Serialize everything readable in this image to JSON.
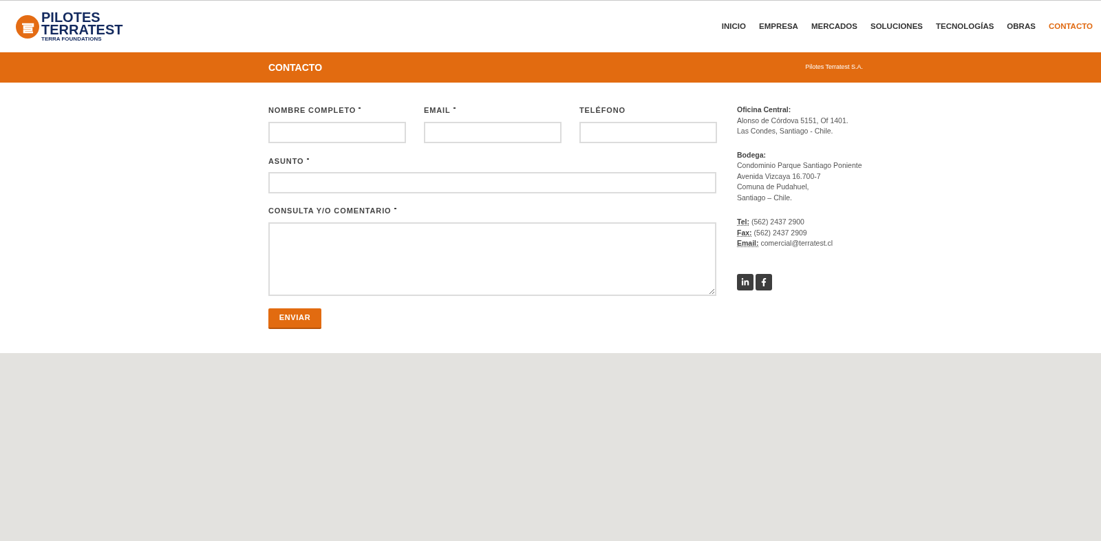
{
  "logo": {
    "line_1": "PILOTES",
    "line_2": "TERRATEST",
    "tagline": "TERRA FOUNDATIONS"
  },
  "nav": [
    {
      "label": "INICIO",
      "selected": false
    },
    {
      "label": "EMPRESA",
      "selected": false
    },
    {
      "label": "MERCADOS",
      "selected": false
    },
    {
      "label": "SOLUCIONES",
      "selected": false
    },
    {
      "label": "TECNOLOGÍAS",
      "selected": false
    },
    {
      "label": "OBRAS",
      "selected": false
    },
    {
      "label": "CONTACTO",
      "selected": true
    }
  ],
  "banner": {
    "title": "CONTACTO",
    "breadcrumb": "Pilotes Terratest S.A."
  },
  "form": {
    "row_fields": [
      {
        "label": "NOMBRE COMPLETO",
        "required": true
      },
      {
        "label": "EMAIL",
        "required": true
      },
      {
        "label": "TELÉFONO",
        "required": false
      }
    ],
    "subject": {
      "label": "ASUNTO",
      "required": true
    },
    "comment": {
      "label": "CONSULTA Y/O COMENTARIO",
      "required": true
    },
    "submit": "ENVIAR"
  },
  "offices": [
    {
      "title": "Oficina Central:",
      "lines": [
        "Alonso de Córdova 5151, Of 1401.",
        "Las Condes, Santiago - Chile."
      ]
    },
    {
      "title": "Bodega:",
      "lines": [
        "Condominio Parque Santiago Poniente",
        "Avenida Vizcaya 16.700-7",
        "Comuna de Pudahuel,",
        "Santiago – Chile."
      ]
    }
  ],
  "contacts": [
    {
      "label": "Tel:",
      "value": "(562) 2437 2900"
    },
    {
      "label": "Fax:",
      "value": "(562) 2437 2909"
    },
    {
      "label": "Email:",
      "value": "comercial@terratest.cl"
    }
  ],
  "social": [
    {
      "kind": "linkedin"
    },
    {
      "kind": "facebook"
    }
  ]
}
